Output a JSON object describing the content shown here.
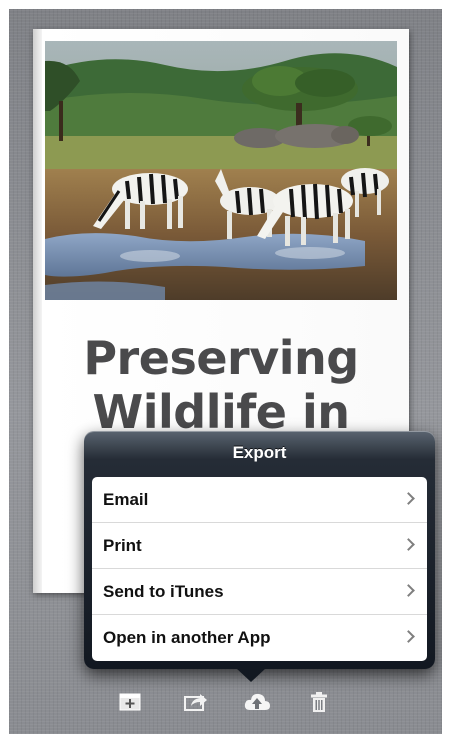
{
  "book": {
    "title": "Preserving\nWildlife in",
    "photo_icon": "zebra-waterhole-photo"
  },
  "popover": {
    "title": "Export",
    "items": [
      {
        "label": "Email"
      },
      {
        "label": "Print"
      },
      {
        "label": "Send to iTunes"
      },
      {
        "label": "Open in another App"
      }
    ]
  },
  "toolbar": {
    "icons": [
      "add-page-icon",
      "share-icon",
      "cloud-export-icon",
      "trash-icon"
    ]
  },
  "colors": {
    "background": "#8c8e93",
    "popover": "#1b222c",
    "title_text": "#4a4a4c"
  }
}
